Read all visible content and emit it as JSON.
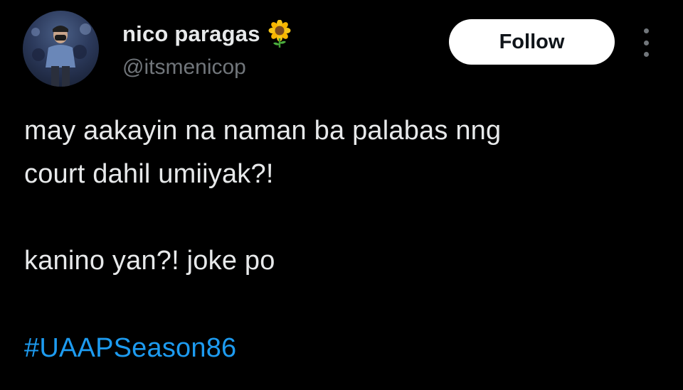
{
  "tweet": {
    "author": {
      "display_name": "nico paragas",
      "emoji_icon": "sunflower-icon",
      "handle": "@itsmenicop"
    },
    "follow_label": "Follow",
    "more_icon": "more-vertical-icon",
    "text_lines": [
      "may aakayin na naman ba palabas nng",
      "court dahil umiiyak?!",
      "kanino yan?! joke po"
    ],
    "hashtag": "#UAAPSeason86"
  },
  "colors": {
    "background": "#000000",
    "text": "#e7e9ea",
    "secondary_text": "#71767b",
    "link": "#1d9bf0",
    "follow_bg": "#ffffff"
  }
}
